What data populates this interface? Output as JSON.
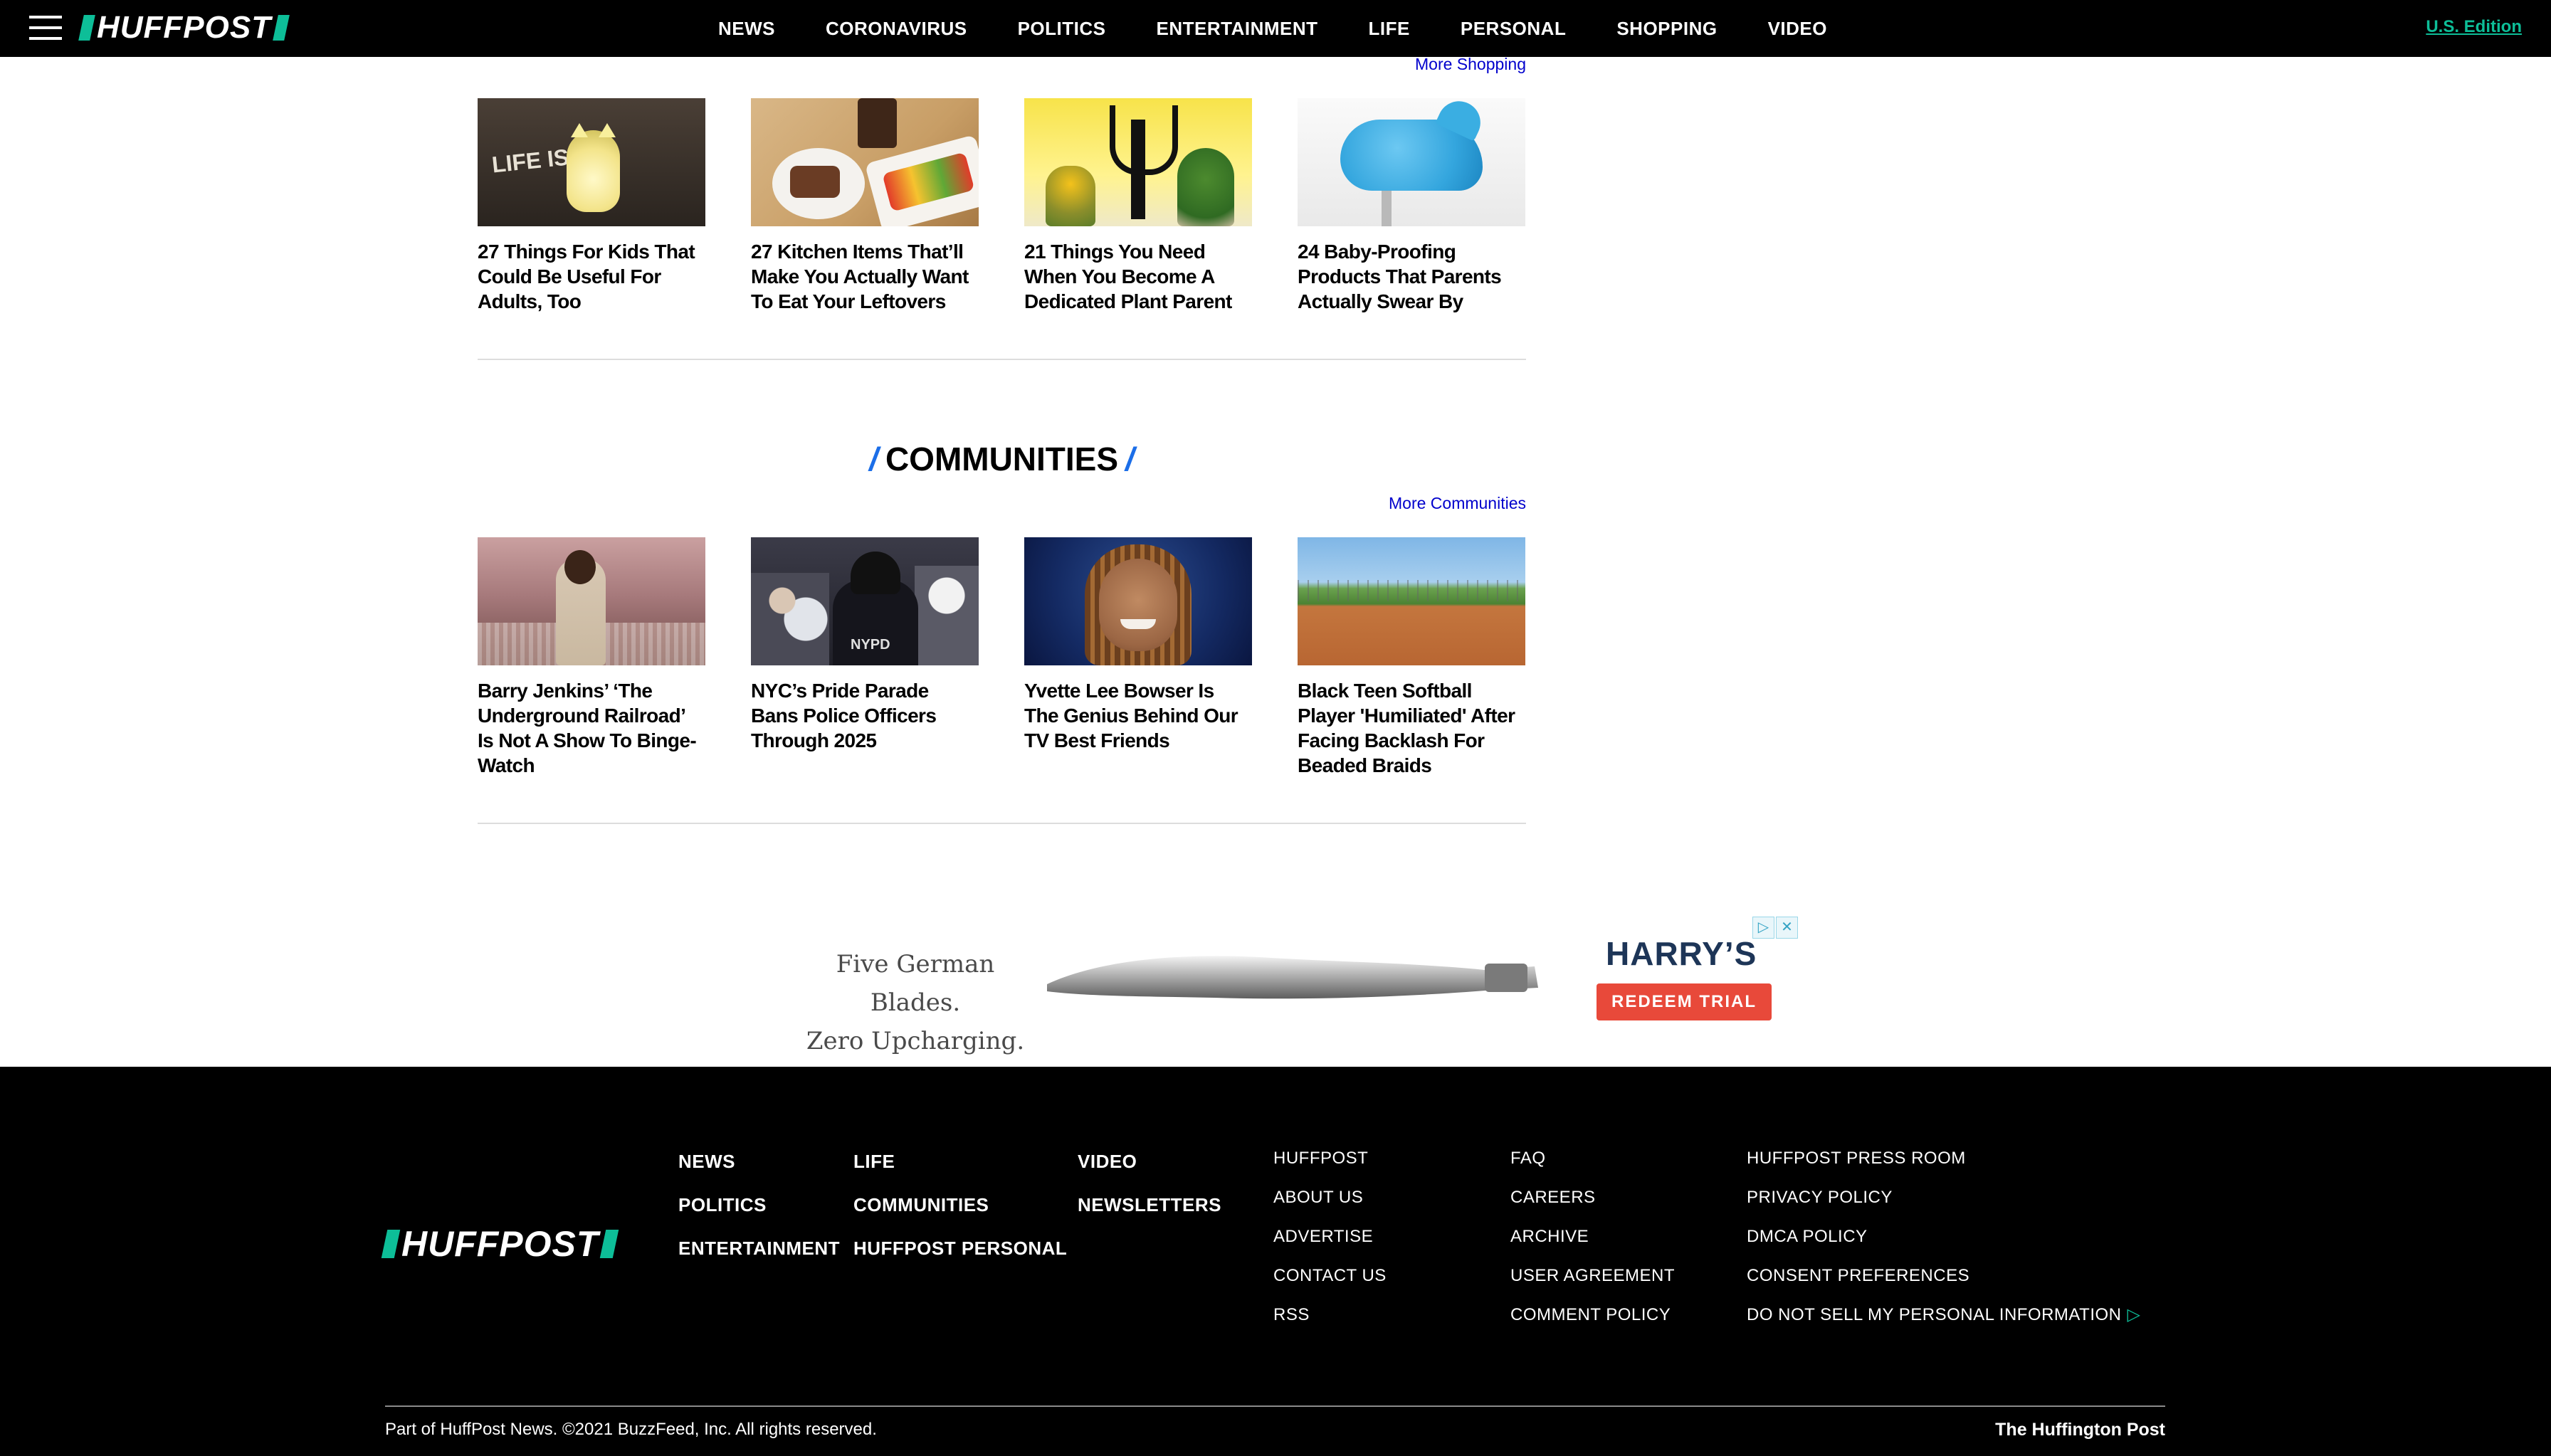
{
  "nav": {
    "logo": "HUFFPOST",
    "links": [
      "NEWS",
      "CORONAVIRUS",
      "POLITICS",
      "ENTERTAINMENT",
      "LIFE",
      "PERSONAL",
      "SHOPPING",
      "VIDEO"
    ],
    "edition": "U.S. Edition"
  },
  "shopping": {
    "more_link": "More Shopping",
    "cards": [
      {
        "title": "27 Things For Kids That Could Be Useful For Adults, Too",
        "image": "cat-night-light"
      },
      {
        "title": "27 Kitchen Items That’ll Make You Actually Want To Eat Your Leftovers",
        "image": "food-plates"
      },
      {
        "title": "21 Things You Need When You Become A Dedicated Plant Parent",
        "image": "grow-lamp-plants"
      },
      {
        "title": "24 Baby-Proofing Products That Parents Actually Swear By",
        "image": "whale-faucet-cover"
      }
    ]
  },
  "communities": {
    "title": "COMMUNITIES",
    "more_link": "More Communities",
    "cards": [
      {
        "title": "Barry Jenkins’ ‘The Underground Railroad’ Is Not A Show To Binge-Watch",
        "image": "woman-in-field"
      },
      {
        "title": "NYC’s Pride Parade Bans Police Officers Through 2025",
        "image": "nypd-officer"
      },
      {
        "title": "Yvette Lee Bowser Is The Genius Behind Our TV Best Friends",
        "image": "smiling-woman"
      },
      {
        "title": "Black Teen Softball Player 'Humiliated' After Facing Backlash For Beaded Braids",
        "image": "softball-field"
      }
    ]
  },
  "ad": {
    "line1": "Five German Blades.",
    "line2": "Zero Upcharging.",
    "brand": "HARRY’S",
    "cta": "REDEEM TRIAL"
  },
  "footer": {
    "logo": "HUFFPOST",
    "col1": [
      "NEWS",
      "POLITICS",
      "ENTERTAINMENT"
    ],
    "col2": [
      "LIFE",
      "COMMUNITIES",
      "HUFFPOST PERSONAL"
    ],
    "col3": [
      "VIDEO",
      "NEWSLETTERS"
    ],
    "col4": [
      "HUFFPOST",
      "ABOUT US",
      "ADVERTISE",
      "CONTACT US",
      "RSS"
    ],
    "col5": [
      "FAQ",
      "CAREERS",
      "ARCHIVE",
      "USER AGREEMENT",
      "COMMENT POLICY"
    ],
    "col6": [
      "HUFFPOST PRESS ROOM",
      "PRIVACY POLICY",
      "DMCA POLICY",
      "CONSENT PREFERENCES",
      "DO NOT SELL MY PERSONAL INFORMATION"
    ],
    "copyright": "Part of HuffPost News. ©2021 BuzzFeed, Inc. All rights reserved.",
    "right": "The Huffington Post"
  },
  "colors": {
    "accent": "#0dbe98",
    "link": "#0000cc",
    "slash": "#1b6ee8",
    "cta": "#e8493a"
  }
}
